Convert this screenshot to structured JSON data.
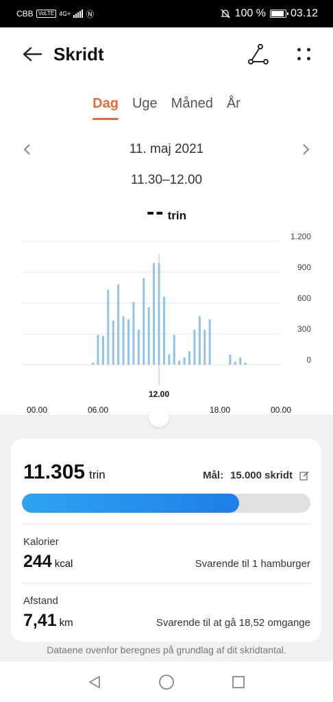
{
  "status_bar": {
    "carrier": "CBB",
    "volte": "VoLTE",
    "network": "4G+",
    "battery": "100 %",
    "time": "03.12"
  },
  "header": {
    "title": "Skridt",
    "back_icon": "arrow-left-icon",
    "route_icon": "route-icon",
    "more_icon": "more-dots-icon"
  },
  "tabs": [
    {
      "label": "Dag",
      "active": true
    },
    {
      "label": "Uge",
      "active": false
    },
    {
      "label": "Måned",
      "active": false
    },
    {
      "label": "År",
      "active": false
    }
  ],
  "date": {
    "label": "11. maj 2021",
    "time_range": "11.30–12.00",
    "selected_value": "--",
    "selected_unit": "trin"
  },
  "chart_data": {
    "type": "bar",
    "y_ticks": [
      "1.200",
      "900",
      "600",
      "300",
      "0"
    ],
    "ylim": [
      0,
      1200
    ],
    "x_ticks": [
      "00.00",
      "06.00",
      "18.00",
      "00.00"
    ],
    "selected_x_label": "12.00",
    "selected_hour": 12,
    "bar_color": "#8ec3ea",
    "bars": [
      {
        "h": 5.5,
        "v": 20
      },
      {
        "h": 6.0,
        "v": 290
      },
      {
        "h": 6.5,
        "v": 280
      },
      {
        "h": 7.0,
        "v": 730
      },
      {
        "h": 7.5,
        "v": 430
      },
      {
        "h": 8.0,
        "v": 780
      },
      {
        "h": 8.5,
        "v": 470
      },
      {
        "h": 9.0,
        "v": 440
      },
      {
        "h": 9.5,
        "v": 610
      },
      {
        "h": 10.0,
        "v": 340
      },
      {
        "h": 10.5,
        "v": 840
      },
      {
        "h": 11.0,
        "v": 560
      },
      {
        "h": 11.5,
        "v": 990
      },
      {
        "h": 12.0,
        "v": 990
      },
      {
        "h": 12.5,
        "v": 660
      },
      {
        "h": 13.0,
        "v": 100
      },
      {
        "h": 13.5,
        "v": 290
      },
      {
        "h": 14.0,
        "v": 40
      },
      {
        "h": 14.5,
        "v": 70
      },
      {
        "h": 15.0,
        "v": 130
      },
      {
        "h": 15.5,
        "v": 340
      },
      {
        "h": 16.0,
        "v": 470
      },
      {
        "h": 16.5,
        "v": 340
      },
      {
        "h": 17.0,
        "v": 440
      },
      {
        "h": 19.0,
        "v": 100
      },
      {
        "h": 19.5,
        "v": 30
      },
      {
        "h": 20.0,
        "v": 70
      },
      {
        "h": 20.5,
        "v": 20
      }
    ]
  },
  "summary": {
    "steps_value": "11.305",
    "steps_unit": "trin",
    "goal_label": "Mål:",
    "goal_value": "15.000 skridt",
    "edit_icon": "edit-icon",
    "progress_fraction": 0.7537,
    "progress_color": "#1e7fe6",
    "calories": {
      "label": "Kalorier",
      "value": "244",
      "unit": "kcal",
      "equivalent": "Svarende til 1 hamburger"
    },
    "distance": {
      "label": "Afstand",
      "value": "7,41",
      "unit": "km",
      "equivalent": "Svarende til at gå 18,52 omgange"
    }
  },
  "footnote": "Dataene ovenfor beregnes på grundlag af dit skridtantal.",
  "nav": {
    "back_icon": "nav-back-icon",
    "home_icon": "nav-home-icon",
    "recents_icon": "nav-recents-icon"
  },
  "accent_color": "#e8693a"
}
